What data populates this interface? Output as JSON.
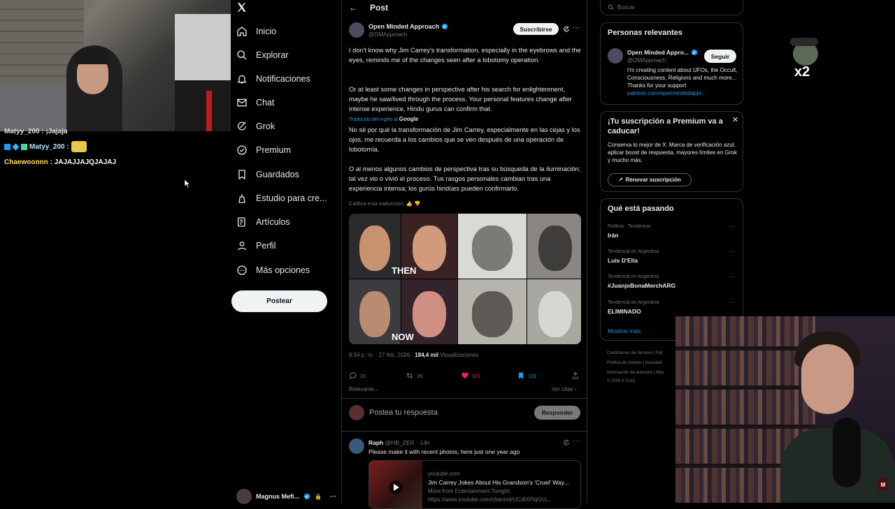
{
  "chat": {
    "line0": "Matyy_200 : ¡Jajaja",
    "line1_user": "Matyy_200 :",
    "line2_user": "Chaewoonnn",
    "line2_text": ": JAJAJJAJQJAJAJ"
  },
  "nav": {
    "items": [
      {
        "label": "Inicio",
        "icon": "home-icon"
      },
      {
        "label": "Explorar",
        "icon": "search-icon"
      },
      {
        "label": "Notificaciones",
        "icon": "bell-icon"
      },
      {
        "label": "Chat",
        "icon": "mail-icon"
      },
      {
        "label": "Grok",
        "icon": "grok-icon"
      },
      {
        "label": "Premium",
        "icon": "verified-icon"
      },
      {
        "label": "Guardados",
        "icon": "bookmark-icon"
      },
      {
        "label": "Estudio para cre...",
        "icon": "creator-icon"
      },
      {
        "label": "Artículos",
        "icon": "article-icon"
      },
      {
        "label": "Perfil",
        "icon": "person-icon"
      },
      {
        "label": "Más opciones",
        "icon": "more-icon"
      }
    ],
    "post_button": "Postear",
    "account_name": "Magnus Mefi..."
  },
  "post": {
    "header": "Post",
    "author_name": "Open Minded Approach",
    "author_handle": "@OMApproach",
    "subscribe": "Suscribirse",
    "text_en_1": "I don't know why Jim Carrey's transformation, especially in the eyebrows and the eyes, reminds me of the changes seen after a lobotomy operation.",
    "text_en_2": "Or at least some changes in perspective after his search for enlightenment, maybe he saw/lived through the process. Your personal features change after intense experience, Hindu gurus can confirm that.",
    "translated_by": "Traducido del inglés al",
    "translated_brand": "Google",
    "text_es_1": "No sé por qué la transformación de Jim Carrey, especialmente en las cejas y los ojos, me recuerda a los cambios que se ven después de una operación de lobotomía.",
    "text_es_2": "O al menos algunos cambios de perspectiva tras su búsqueda de la iluminación; tal vez vio o vivió el proceso. Tus rasgos personales cambian tras una experiencia intensa; los gurús hindúes pueden confirmarlo.",
    "rate_translation": "Califica esta traducción:",
    "media_then": "THEN",
    "media_now": "NOW",
    "timestamp": "8:34 p. m. · 27 feb. 2026 ·",
    "views_count": "184,4 mil",
    "views_label": "Visualizaciones",
    "replies": "20",
    "reposts": "28",
    "likes": "331",
    "bookmarks": "119",
    "sort": "Relevante",
    "view_quotes": "Ver citas",
    "reply_placeholder": "Postea tu respuesta",
    "reply_button": "Responder"
  },
  "reply": {
    "name": "Raph",
    "handle": "@HB_ZER · 14h",
    "text": "Please make it with recent photos, here just one year ago",
    "card_domain": "youtube.com",
    "card_title": "Jim Carrey Jokes About His Grandson's 'Cruel' Way...",
    "card_desc": "More from Entertainment Tonight:",
    "card_url": "https://www.youtube.com/channel/UCdtXPiqI2cL..."
  },
  "sidebar": {
    "search_placeholder": "Buscar",
    "relevant": {
      "title": "Personas relevantes",
      "name": "Open Minded Appro...",
      "handle": "@OMApproach",
      "follow": "Seguir",
      "bio": "I'm creating content about UFOs, the Occult, Consciousness, Religions and much more... Thanks for your support",
      "link": "patreon.com/openmindedappr..."
    },
    "premium": {
      "title": "¡Tu suscripción a Premium va a caducar!",
      "text": "Conserva lo mejor de X. Marca de verificación azul, aplicar boost de respuesta, mayores límites en Grok y mucho más.",
      "button": "Renovar suscripción"
    },
    "trends": {
      "title": "Qué está pasando",
      "items": [
        {
          "category": "Política · Tendencia",
          "name": "Irán"
        },
        {
          "category": "Tendencia en Argentina",
          "name": "Luis D'Elía"
        },
        {
          "category": "Tendencia en Argentina",
          "name": "#JuanjoBonaMerchARG"
        },
        {
          "category": "Tendencia en Argentina",
          "name": "ELIMINADO"
        }
      ],
      "show_more": "Mostrar más"
    },
    "footer": {
      "l1": "Condiciones de Servicio  |  Polí",
      "l2": "Política de cookies  |  Accesibil",
      "l3": "Información de anuncios  |  Más",
      "l4": "© 2026 X Corp."
    }
  },
  "overlay": {
    "emote_text": "x2",
    "cam_logo": "M"
  },
  "colors": {
    "accent": "#1d9bf0",
    "like": "#f91880",
    "background": "#000000",
    "border": "#2f3336"
  }
}
